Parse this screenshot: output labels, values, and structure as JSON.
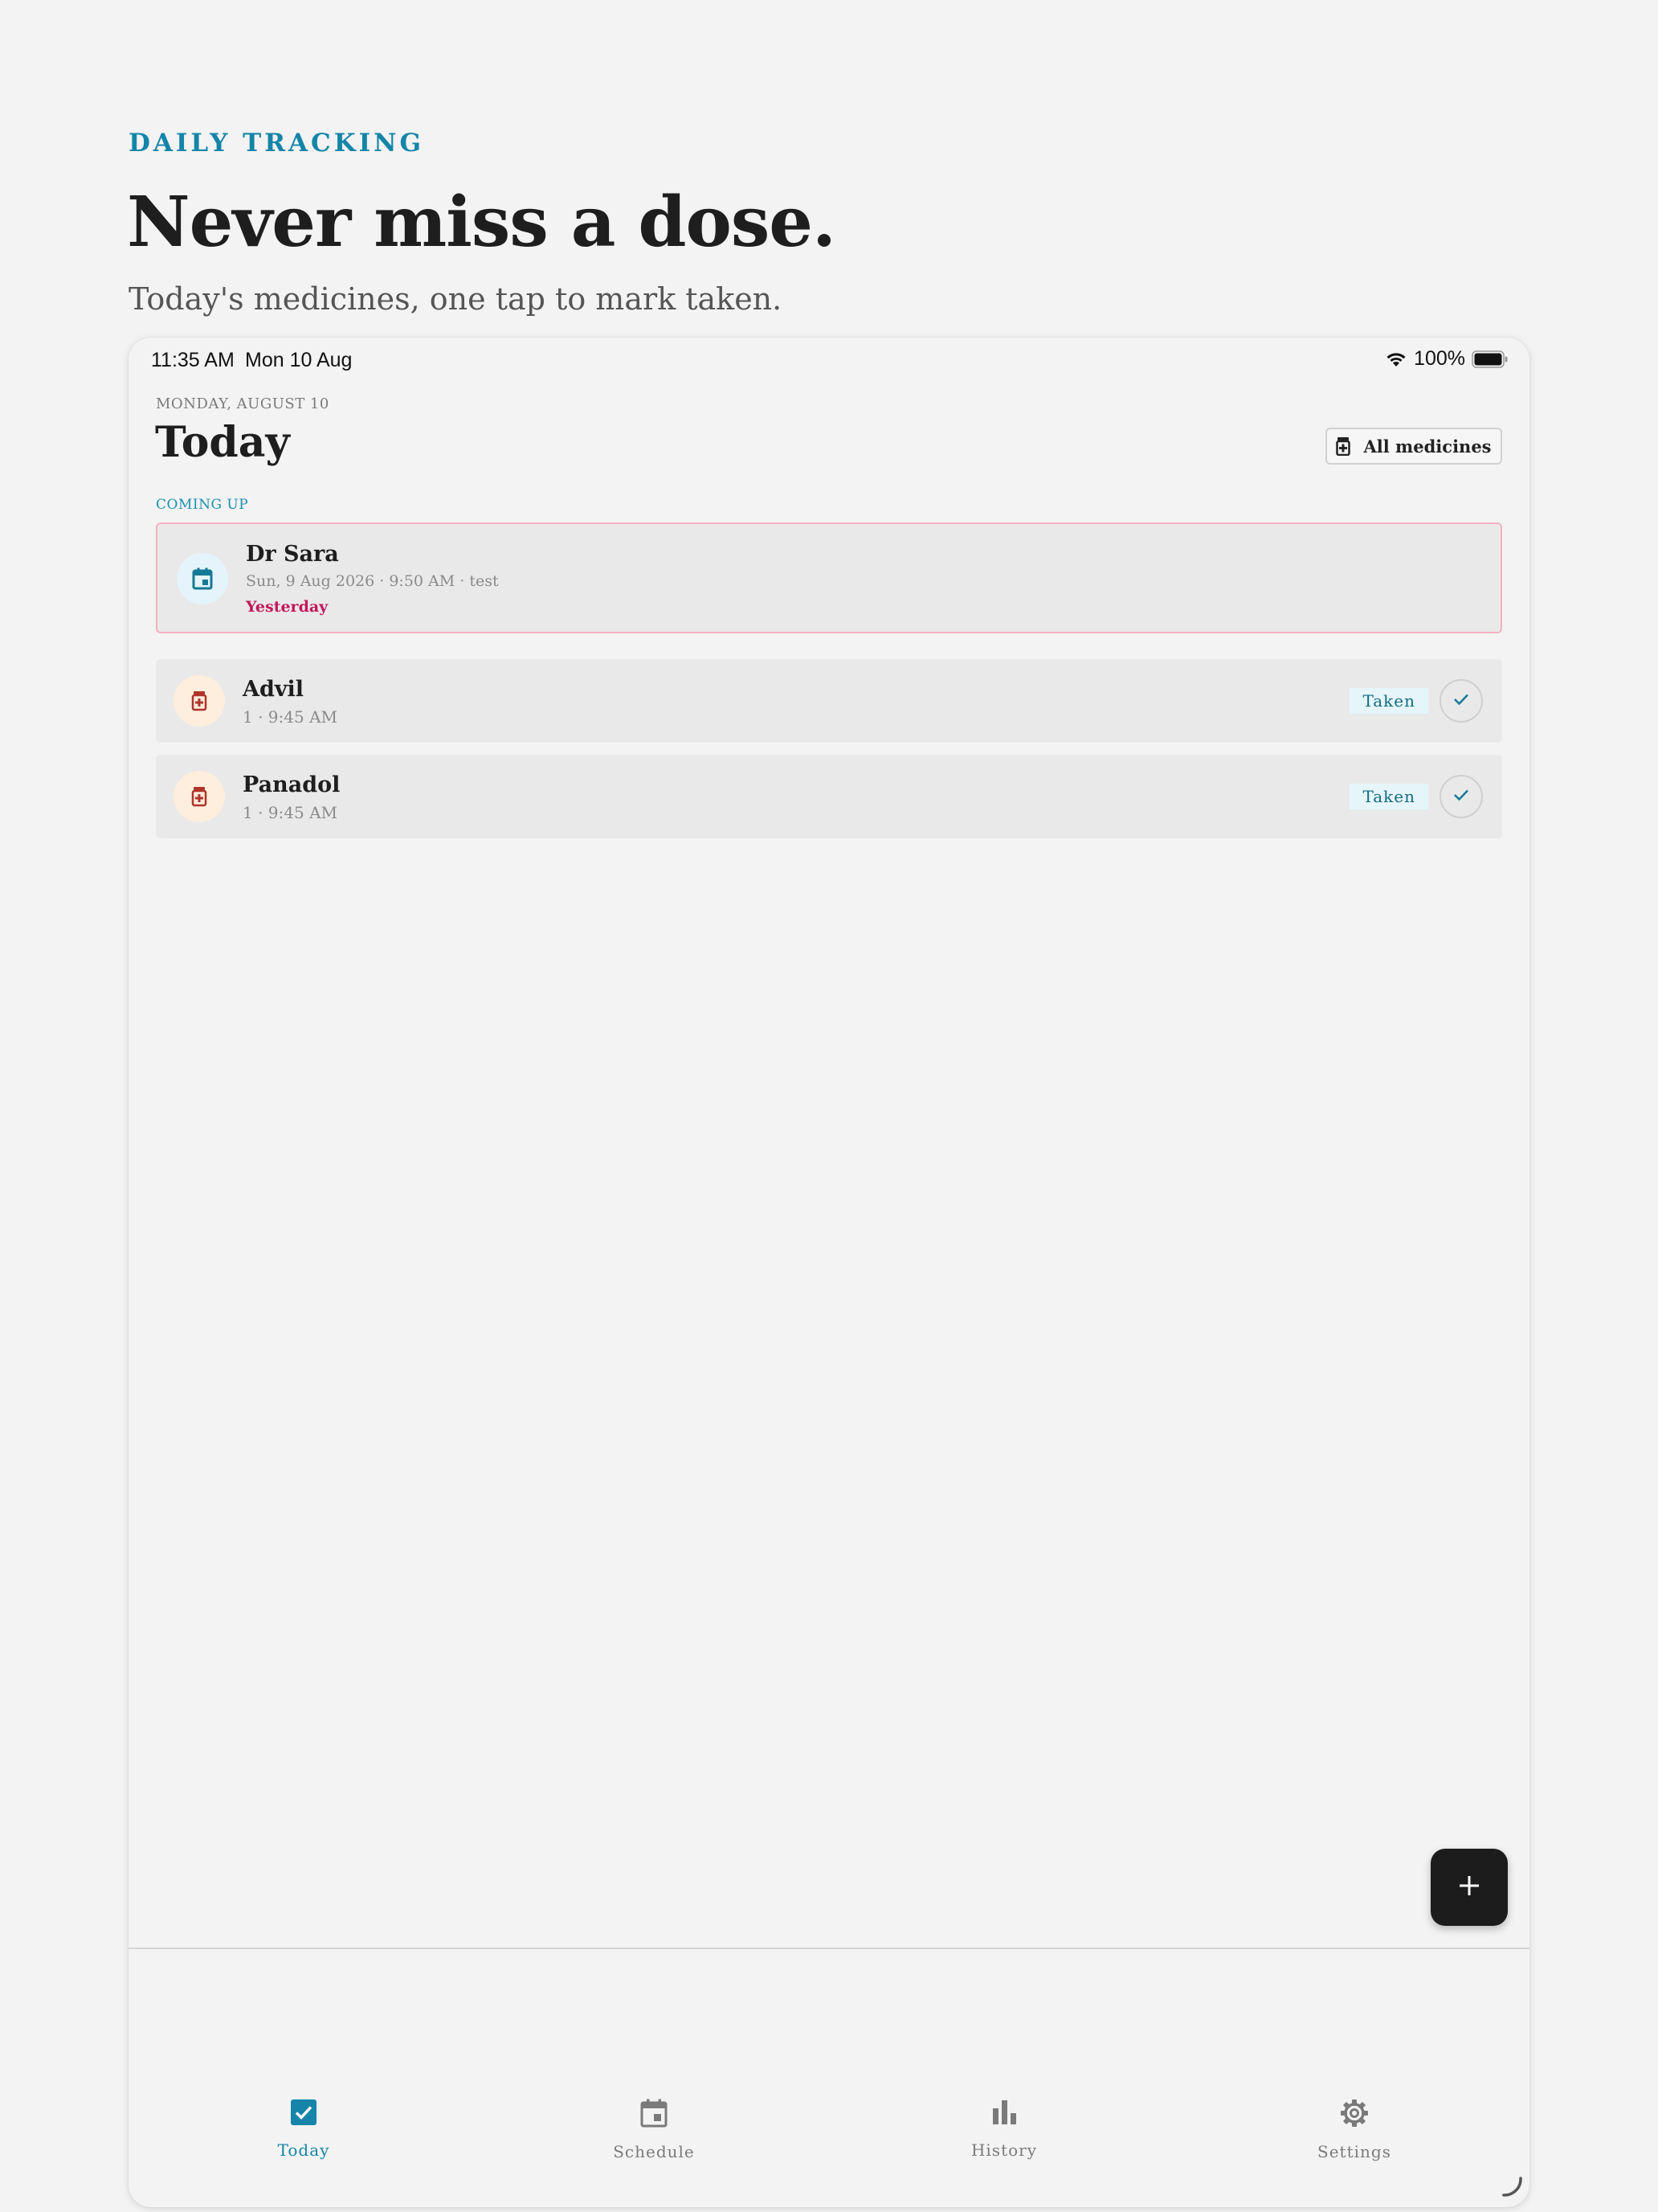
{
  "hero": {
    "eyebrow": "DAILY TRACKING",
    "headline": "Never miss a dose.",
    "subline": "Today's medicines, one tap to mark taken."
  },
  "status_bar": {
    "time": "11:35 AM",
    "date": "Mon 10 Aug",
    "battery": "100%"
  },
  "screen": {
    "date_label": "MONDAY, AUGUST 10",
    "title": "Today",
    "all_medicines_label": "All medicines",
    "coming_up_label": "COMING UP"
  },
  "appointment": {
    "name": "Dr Sara",
    "meta": "Sun, 9 Aug 2026 · 9:50 AM · test",
    "relative": "Yesterday",
    "icon": "calendar-icon"
  },
  "medicines": [
    {
      "name": "Advil",
      "meta": "1 · 9:45 AM",
      "status": "Taken",
      "icon": "pill-bottle-icon"
    },
    {
      "name": "Panadol",
      "meta": "1 · 9:45 AM",
      "status": "Taken",
      "icon": "pill-bottle-icon"
    }
  ],
  "fab": {
    "icon": "plus-icon"
  },
  "nav": [
    {
      "label": "Today",
      "icon": "checkbox-icon",
      "active": true
    },
    {
      "label": "Schedule",
      "icon": "calendar-icon",
      "active": false
    },
    {
      "label": "History",
      "icon": "bar-chart-icon",
      "active": false
    },
    {
      "label": "Settings",
      "icon": "gear-icon",
      "active": false
    }
  ],
  "colors": {
    "accent": "#1485a8",
    "appointment_border": "#f2b2c2",
    "overdue_text": "#c2185b",
    "fab": "#1c1c1c"
  }
}
